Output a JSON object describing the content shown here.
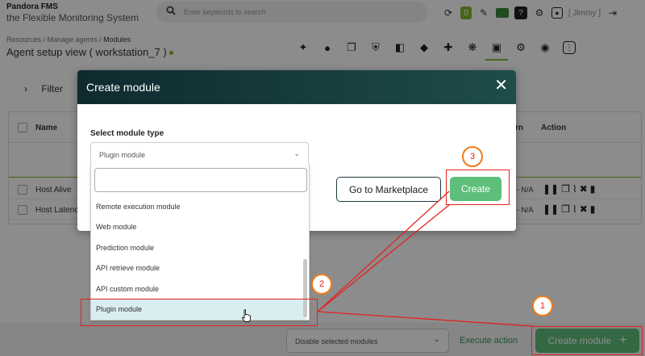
{
  "brand": {
    "name": "Pandora FMS",
    "tagline": "the Flexible Monitoring System"
  },
  "search": {
    "placeholder": "Enter keywords to search"
  },
  "header": {
    "badge_count": "0",
    "user": "[ Jimmy ]"
  },
  "breadcrumb": {
    "part1": "Resources / ",
    "part2": "Manage agents / ",
    "current": "Modules"
  },
  "page": {
    "title": "Agent setup view ( workstation_7 )"
  },
  "filter": {
    "label": "Filter"
  },
  "table": {
    "col_name": "Name",
    "col_rn": "rn",
    "col_action": "Action",
    "rows": [
      {
        "name": "Host Alive",
        "value": "- N/A"
      },
      {
        "name": "Host Latency",
        "value": "- N/A"
      }
    ]
  },
  "footer": {
    "bulk_select": "Disable selected modules",
    "execute": "Execute action",
    "create_module": "Create module",
    "create_plus": "+"
  },
  "modal": {
    "title": "Create module",
    "close": "✕",
    "type_label": "Select module type",
    "type_value": "Plugin module",
    "marketplace": "Go to Marketplace",
    "create": "Create"
  },
  "dropdown": {
    "items": [
      "Remote execution module",
      "Web module",
      "Prediction module",
      "API retrieve module",
      "API custom module",
      "Plugin module"
    ]
  },
  "annotations": {
    "step1": "1",
    "step2": "2",
    "step3": "3"
  },
  "colors": {
    "accent_green": "#82b92e",
    "button_green": "#5fbe7a",
    "annotation_red": "#e42121",
    "annotation_orange": "#f07b1a",
    "modal_header": "#1e4d49"
  }
}
